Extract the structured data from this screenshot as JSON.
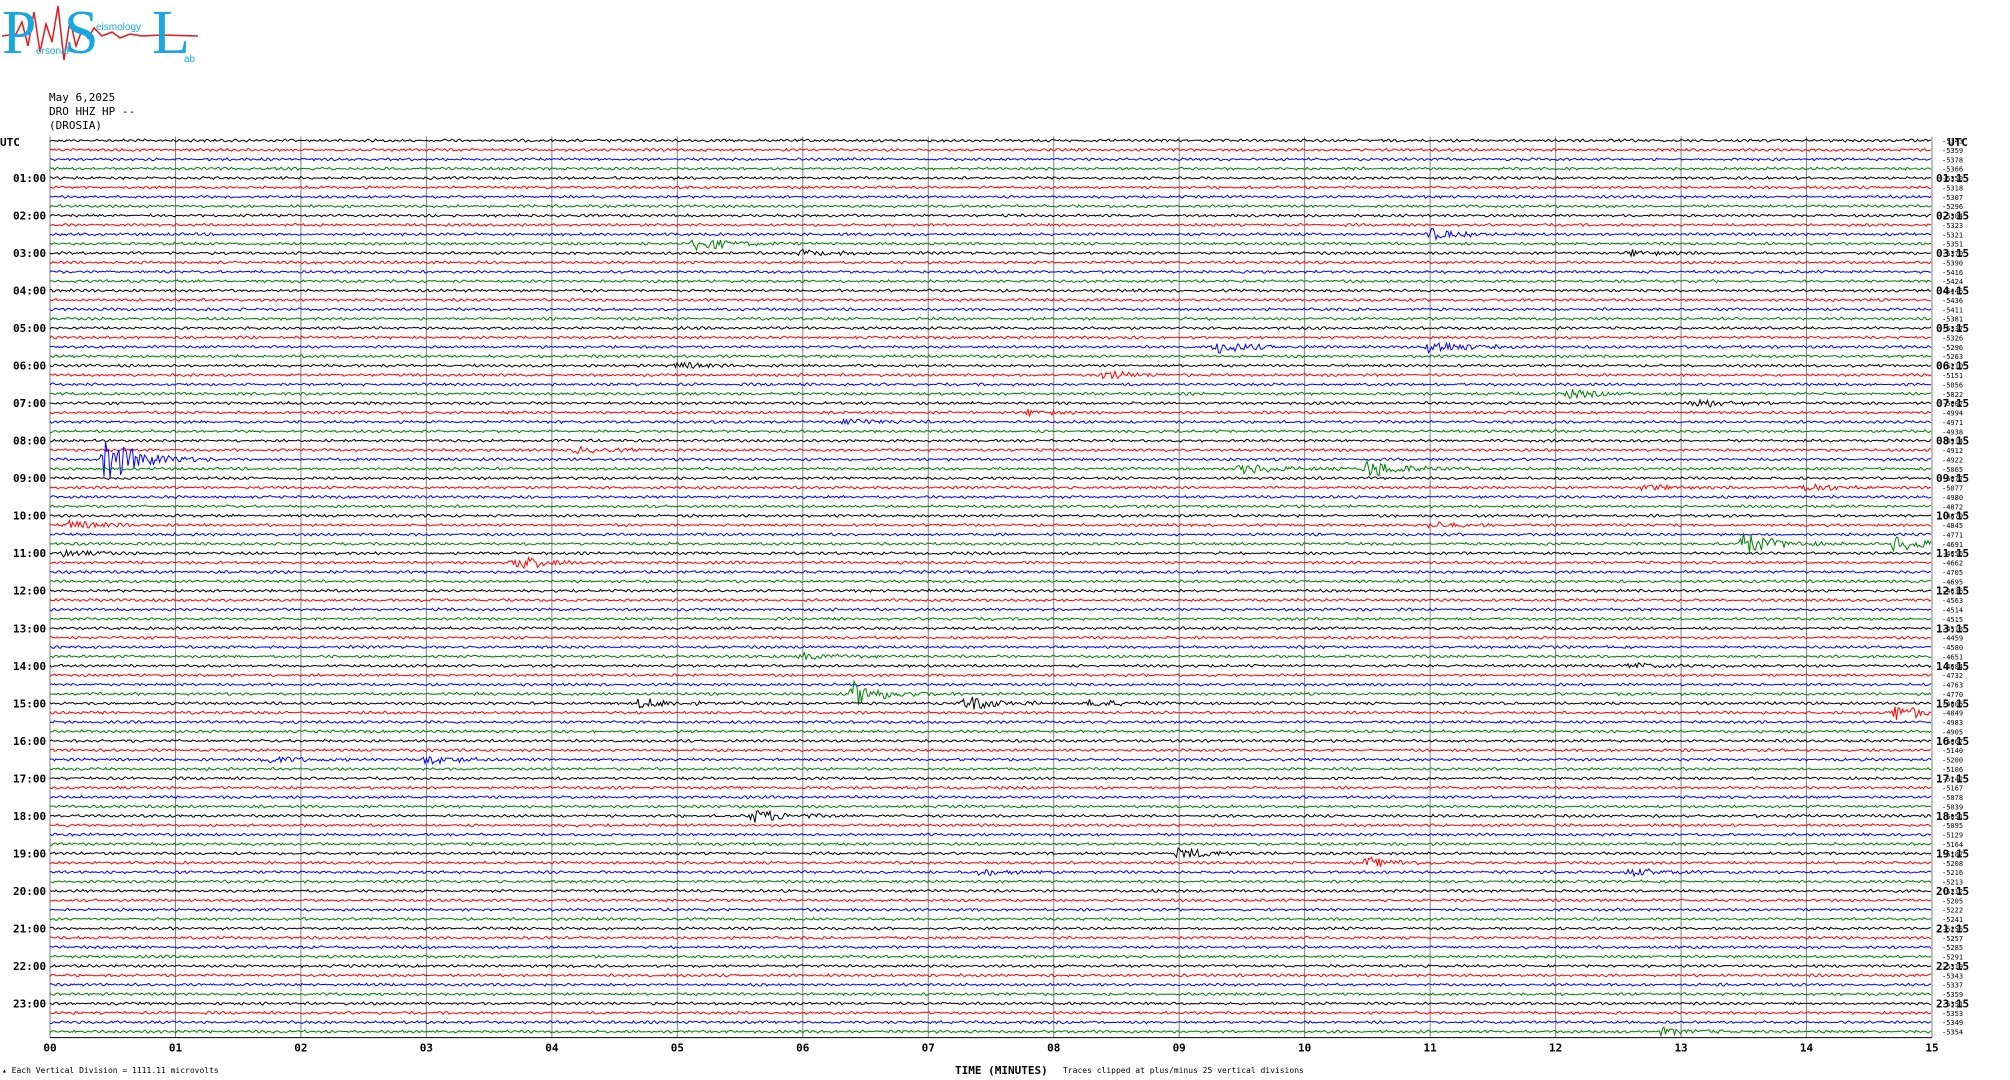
{
  "logo": {
    "letters": [
      "P",
      "S",
      "L"
    ],
    "small_words": [
      "ersonal",
      "eismology",
      "ab"
    ]
  },
  "header": {
    "date": "May 6,2025",
    "station": "DRO HHZ HP --",
    "location": "(DROSIA)"
  },
  "utc_left_label": "UTC",
  "utc_right_label": "UTC",
  "footer": {
    "left": "Each Vertical Division = 1111.11 microvolts",
    "center": "TIME (MINUTES)",
    "right": "Traces clipped at plus/minus 25 vertical divisions"
  },
  "colors": {
    "black": "#000000",
    "red": "#ff0000",
    "blue": "#0000ff",
    "green": "#007f00",
    "grid": "#7f7f7f"
  },
  "chart_data": {
    "type": "line",
    "xlabel": "TIME (MINUTES)",
    "x_ticks": [
      "00",
      "01",
      "02",
      "03",
      "04",
      "05",
      "06",
      "07",
      "08",
      "09",
      "10",
      "11",
      "12",
      "13",
      "14",
      "15"
    ],
    "xlim": [
      0,
      15
    ],
    "left_hour_labels": [
      "01:00",
      "02:00",
      "03:00",
      "04:00",
      "05:00",
      "06:00",
      "07:00",
      "08:00",
      "09:00",
      "10:00",
      "11:00",
      "12:00",
      "13:00",
      "14:00",
      "15:00",
      "16:00",
      "17:00",
      "18:00",
      "19:00",
      "20:00",
      "21:00",
      "22:00",
      "23:00"
    ],
    "right_hour_labels": [
      "01:15",
      "02:15",
      "03:15",
      "04:15",
      "05:15",
      "06:15",
      "07:15",
      "08:15",
      "09:15",
      "10:15",
      "11:15",
      "12:15",
      "13:15",
      "14:15",
      "15:15",
      "16:15",
      "17:15",
      "18:15",
      "19:15",
      "20:15",
      "21:15",
      "22:15",
      "23:15"
    ],
    "trace_color_cycle": [
      "black",
      "red",
      "blue",
      "green"
    ],
    "trace_count": 96,
    "offsets": [
      "-5343",
      "-5359",
      "-5378",
      "-5366",
      "-5350",
      "-5318",
      "-5307",
      "-5296",
      "-5304",
      "-5323",
      "-5321",
      "-5351",
      "-5370",
      "-5390",
      "-5416",
      "-5424",
      "-5445",
      "-5436",
      "-5411",
      "-5381",
      "-5337",
      "-5326",
      "-5296",
      "-5263",
      "-5210",
      "-5151",
      "-5056",
      "-5022",
      "-5007",
      "-4994",
      "-4971",
      "-4938",
      "-4914",
      "-4912",
      "-4922",
      "-5065",
      "-5077",
      "-5077",
      "-4980",
      "-4872",
      "-4879",
      "-4845",
      "-4771",
      "-4691",
      "-4656",
      "-4662",
      "-4705",
      "-4695",
      "-4636",
      "-4563",
      "-4514",
      "-4515",
      "-4513",
      "-4459",
      "-4580",
      "-4651",
      "-4684",
      "-4732",
      "-4763",
      "-4770",
      "-4805",
      "-4849",
      "-4983",
      "-4905",
      "-5067",
      "-5140",
      "-5200",
      "-5106",
      "-5142",
      "-5167",
      "-5078",
      "-5039",
      "-5051",
      "-5095",
      "-5129",
      "-5164",
      "-5187",
      "-5208",
      "-5216",
      "-5213",
      "-5212",
      "-5205",
      "-5222",
      "-5241",
      "-5255",
      "-5257",
      "-5285",
      "-5291",
      "-5319",
      "-5343",
      "-5337",
      "-5359",
      "-5351",
      "-5353",
      "-5349",
      "-5354"
    ],
    "events": [
      {
        "trace": 11,
        "minute": 5.15,
        "amplitude": 7
      },
      {
        "trace": 12,
        "minute": 6.0,
        "amplitude": 3
      },
      {
        "trace": 10,
        "minute": 11.0,
        "amplitude": 5
      },
      {
        "trace": 12,
        "minute": 12.6,
        "amplitude": 3
      },
      {
        "trace": 22,
        "minute": 9.3,
        "amplitude": 6
      },
      {
        "trace": 22,
        "minute": 11.0,
        "amplitude": 7
      },
      {
        "trace": 24,
        "minute": 5.0,
        "amplitude": 3
      },
      {
        "trace": 25,
        "minute": 8.4,
        "amplitude": 4
      },
      {
        "trace": 27,
        "minute": 12.1,
        "amplitude": 4
      },
      {
        "trace": 28,
        "minute": 13.1,
        "amplitude": 5
      },
      {
        "trace": 29,
        "minute": 7.8,
        "amplitude": 3
      },
      {
        "trace": 30,
        "minute": 6.35,
        "amplitude": 3
      },
      {
        "trace": 34,
        "minute": 0.45,
        "amplitude": 26
      },
      {
        "trace": 33,
        "minute": 4.2,
        "amplitude": 3
      },
      {
        "trace": 35,
        "minute": 9.5,
        "amplitude": 5
      },
      {
        "trace": 35,
        "minute": 10.5,
        "amplitude": 10
      },
      {
        "trace": 37,
        "minute": 14.0,
        "amplitude": 4
      },
      {
        "trace": 37,
        "minute": 12.7,
        "amplitude": 3
      },
      {
        "trace": 41,
        "minute": 0.15,
        "amplitude": 4
      },
      {
        "trace": 41,
        "minute": 11.0,
        "amplitude": 3
      },
      {
        "trace": 43,
        "minute": 13.5,
        "amplitude": 11
      },
      {
        "trace": 43,
        "minute": 14.7,
        "amplitude": 8
      },
      {
        "trace": 45,
        "minute": 3.7,
        "amplitude": 8
      },
      {
        "trace": 44,
        "minute": 0.1,
        "amplitude": 3
      },
      {
        "trace": 55,
        "minute": 6.0,
        "amplitude": 3
      },
      {
        "trace": 56,
        "minute": 12.6,
        "amplitude": 3
      },
      {
        "trace": 59,
        "minute": 6.4,
        "amplitude": 12
      },
      {
        "trace": 60,
        "minute": 7.3,
        "amplitude": 8
      },
      {
        "trace": 60,
        "minute": 4.7,
        "amplitude": 5
      },
      {
        "trace": 60,
        "minute": 8.3,
        "amplitude": 4
      },
      {
        "trace": 61,
        "minute": 14.7,
        "amplitude": 8
      },
      {
        "trace": 66,
        "minute": 1.7,
        "amplitude": 4
      },
      {
        "trace": 66,
        "minute": 3.0,
        "amplitude": 5
      },
      {
        "trace": 72,
        "minute": 5.6,
        "amplitude": 7
      },
      {
        "trace": 76,
        "minute": 9.0,
        "amplitude": 6
      },
      {
        "trace": 77,
        "minute": 10.5,
        "amplitude": 5
      },
      {
        "trace": 78,
        "minute": 7.4,
        "amplitude": 3
      },
      {
        "trace": 78,
        "minute": 12.6,
        "amplitude": 4
      },
      {
        "trace": 95,
        "minute": 12.85,
        "amplitude": 4
      }
    ]
  }
}
